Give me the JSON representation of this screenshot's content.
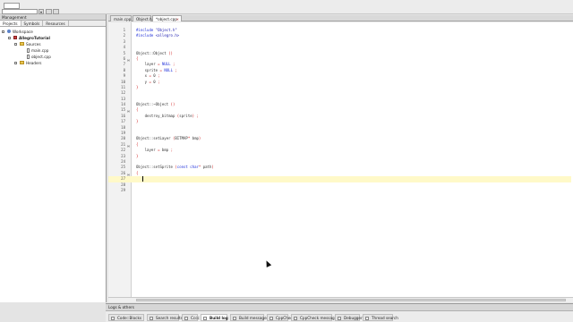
{
  "management": {
    "title": "Management",
    "tabs": [
      "Projects",
      "Symbols",
      "Resources"
    ],
    "tree": {
      "workspace": "Workspace",
      "project": "AllegroTutorial",
      "sources": "Sources",
      "file_main": "main.cpp",
      "file_object": "object.cpp",
      "headers": "Headers"
    }
  },
  "editor": {
    "tabs": [
      {
        "label": "main.cpp",
        "active": false
      },
      {
        "label": "Object.h",
        "active": false
      },
      {
        "label": "*object.cpp",
        "active": true
      }
    ],
    "close_glyph": "×",
    "lines": [
      "#include \"Object.h\"",
      "#include <allegro.h>",
      "",
      "",
      "Object::Object ()",
      "{",
      "    layer = NULL ;",
      "    sprite = NULL ;",
      "    x = 0 ;",
      "    y = 0 ;",
      "}",
      "",
      "",
      "Object::~Object ()",
      "{",
      "    destroy_bitmap (sprite) ;",
      "}",
      "",
      "",
      "Object::setLayer (BITMAP* bmp)",
      "{",
      "    layer = bmp ;",
      "}",
      "",
      "Object::setSprite (const char* path)",
      "{",
      "    ",
      "",
      ""
    ],
    "current_line": 27
  },
  "logs": {
    "title": "Logs & others",
    "tabs": [
      {
        "label": "Code::Blocks",
        "active": false
      },
      {
        "label": "Search results",
        "active": false
      },
      {
        "label": "Cccc",
        "active": false
      },
      {
        "label": "Build log",
        "active": true
      },
      {
        "label": "Build messages",
        "active": false
      },
      {
        "label": "CppCheck",
        "active": false
      },
      {
        "label": "CppCheck messages",
        "active": false
      },
      {
        "label": "Debugger",
        "active": false
      },
      {
        "label": "Thread search",
        "active": false
      }
    ]
  },
  "colors": {
    "keyword": "#1c2dd9",
    "string": "#1a1ab0",
    "symbol": "#d02020",
    "current_line": "#fff9c8"
  }
}
